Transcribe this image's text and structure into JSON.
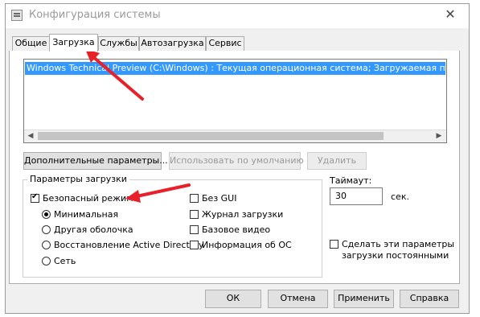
{
  "window": {
    "title": "Конфигурация системы",
    "close_glyph": "✕"
  },
  "tabs": [
    {
      "label": "Общие"
    },
    {
      "label": "Загрузка"
    },
    {
      "label": "Службы"
    },
    {
      "label": "Автозагрузка"
    },
    {
      "label": "Сервис"
    }
  ],
  "boot_list": {
    "selected_entry": "Windows Technical Preview (C:\\Windows) : Текущая операционная система; Загружаемая по умолчанию"
  },
  "boot_actions": {
    "advanced_label": "Дополнительные параметры...",
    "set_default_label": "Использовать по умолчанию",
    "delete_label": "Удалить"
  },
  "boot_options": {
    "group_label": "Параметры загрузки",
    "safe_boot": {
      "label": "Безопасный режим",
      "checked": true
    },
    "radios": [
      {
        "label": "Минимальная",
        "checked": true
      },
      {
        "label": "Другая оболочка",
        "checked": false
      },
      {
        "label": "Восстановление Active Directory",
        "checked": false
      },
      {
        "label": "Сеть",
        "checked": false
      }
    ],
    "checks": [
      {
        "label": "Без GUI",
        "checked": false
      },
      {
        "label": "Журнал загрузки",
        "checked": false
      },
      {
        "label": "Базовое видео",
        "checked": false
      },
      {
        "label": "Информация  об ОС",
        "checked": false
      }
    ]
  },
  "timeout": {
    "label": "Таймаут:",
    "value": "30",
    "unit": "сек."
  },
  "permanent": {
    "label_line1": "Сделать эти параметры",
    "label_line2": "загрузки постоянными",
    "checked": false
  },
  "footer": {
    "ok_label": "ОК",
    "cancel_label": "Отмена",
    "apply_label": "Применить",
    "help_label": "Справка"
  },
  "colors": {
    "selection": "#3399ff",
    "annotation_arrow": "#e8202a"
  }
}
